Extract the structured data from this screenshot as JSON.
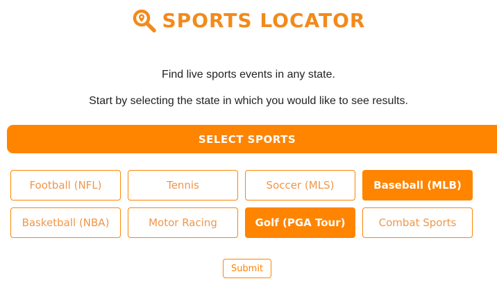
{
  "header": {
    "title": "SPORTS LOCATOR",
    "icon": "map-pin-search-icon",
    "accent_color": "#f28a1b"
  },
  "intro": {
    "line1": "Find live sports events in any state.",
    "line2": "Start by selecting the state in which you would like to see results."
  },
  "select_bar": {
    "label": "SELECT SPORTS",
    "color": "#ff8400"
  },
  "sports": [
    {
      "label": "Football (NFL)",
      "selected": false
    },
    {
      "label": "Tennis",
      "selected": false
    },
    {
      "label": "Soccer (MLS)",
      "selected": false
    },
    {
      "label": "Baseball (MLB)",
      "selected": true
    },
    {
      "label": "Basketball (NBA)",
      "selected": false
    },
    {
      "label": "Motor Racing",
      "selected": false
    },
    {
      "label": "Golf (PGA Tour)",
      "selected": true
    },
    {
      "label": "Combat Sports",
      "selected": false
    }
  ],
  "submit": {
    "label": "Submit"
  }
}
